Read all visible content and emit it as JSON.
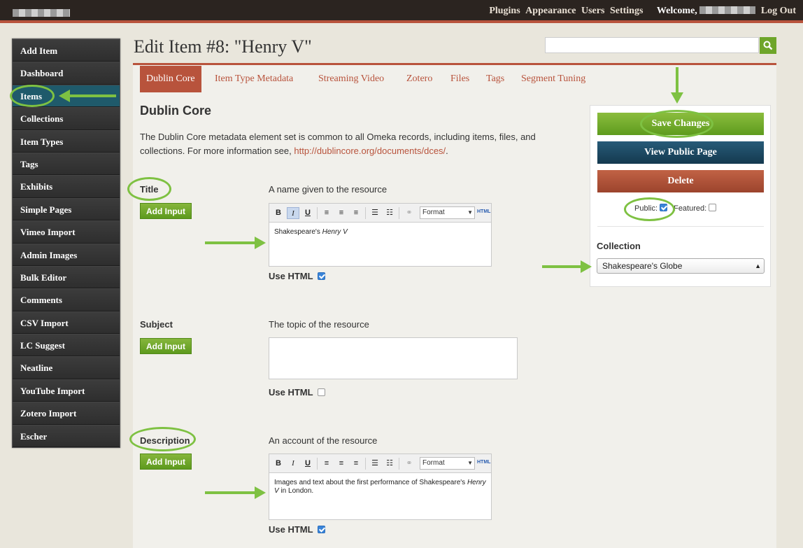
{
  "topbar": {
    "nav": [
      "Plugins",
      "Appearance",
      "Users",
      "Settings"
    ],
    "welcome": "Welcome,",
    "logout": "Log Out"
  },
  "sidebar": {
    "items": [
      {
        "label": "Add Item"
      },
      {
        "label": "Dashboard"
      },
      {
        "label": "Items",
        "active": true
      },
      {
        "label": "Collections"
      },
      {
        "label": "Item Types"
      },
      {
        "label": "Tags"
      },
      {
        "label": "Exhibits"
      },
      {
        "label": "Simple Pages"
      },
      {
        "label": "Vimeo Import"
      },
      {
        "label": "Admin Images"
      },
      {
        "label": "Bulk Editor"
      },
      {
        "label": "Comments"
      },
      {
        "label": "CSV Import"
      },
      {
        "label": "LC Suggest"
      },
      {
        "label": "Neatline"
      },
      {
        "label": "YouTube Import"
      },
      {
        "label": "Zotero Import"
      },
      {
        "label": "Escher"
      }
    ]
  },
  "page": {
    "title": "Edit Item #8: \"Henry V\""
  },
  "search": {
    "placeholder": "",
    "icon": "search-icon"
  },
  "tabs": [
    {
      "label": "Dublin Core",
      "active": true
    },
    {
      "label": "Item Type Metadata"
    },
    {
      "label": "Streaming Video"
    },
    {
      "label": "Zotero"
    },
    {
      "label": "Files"
    },
    {
      "label": "Tags"
    },
    {
      "label": "Segment Tuning"
    }
  ],
  "section": {
    "title": "Dublin Core",
    "desc": "The Dublin Core metadata element set is common to all Omeka records, including items, files, and collections. For more information see, ",
    "link": "http://dublincore.org/documents/dces/",
    "desc_end": "."
  },
  "fields": {
    "title": {
      "label": "Title",
      "help": "A name given to the resource",
      "add_input": "Add Input",
      "content_pre": "Shakespeare's ",
      "content_em": "Henry V",
      "content_post": "",
      "use_html": "Use HTML",
      "use_html_checked": true
    },
    "subject": {
      "label": "Subject",
      "help": "The topic of the resource",
      "add_input": "Add Input",
      "use_html": "Use HTML",
      "use_html_checked": false
    },
    "description": {
      "label": "Description",
      "help": "An account of the resource",
      "add_input": "Add Input",
      "content_pre": "Images and text about the first performance of Shakespeare's ",
      "content_em": "Henry V",
      "content_post": " in London.",
      "use_html": "Use HTML",
      "use_html_checked": true
    }
  },
  "editor_toolbar": {
    "bold": "B",
    "italic": "I",
    "underline": "U",
    "format": "Format",
    "html": "HTML"
  },
  "panel": {
    "save": "Save Changes",
    "view": "View Public Page",
    "delete": "Delete",
    "public_label": "Public:",
    "public_checked": true,
    "featured_label": "Featured:",
    "featured_checked": false,
    "collection_label": "Collection",
    "collection_value": "Shakespeare's Globe"
  },
  "colors": {
    "accent": "#b8533c",
    "topbar": "#2b2420",
    "green": "#6ea52a",
    "annotation": "#7ec142",
    "sidebar_active": "#1f5a6b"
  }
}
